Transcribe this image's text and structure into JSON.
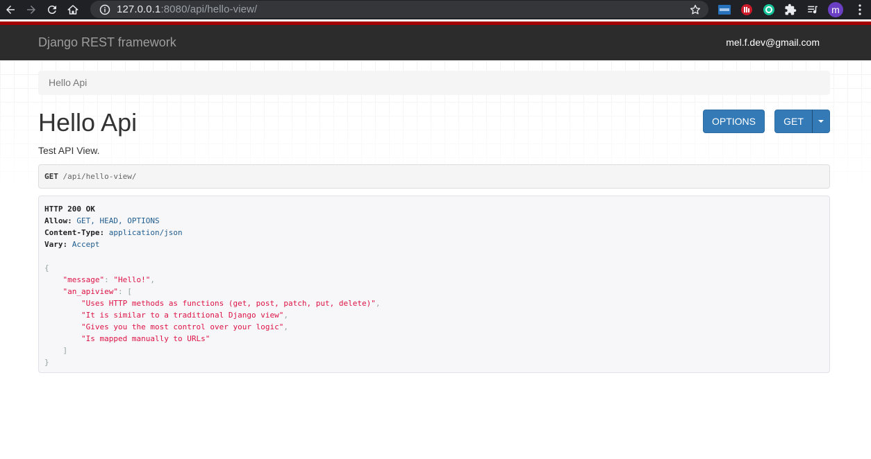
{
  "browser": {
    "url_host": "127.0.0.1",
    "url_rest": ":8080/api/hello-view/",
    "profile_initial": "m"
  },
  "navbar": {
    "brand": "Django REST framework",
    "user": "mel.f.dev@gmail.com"
  },
  "breadcrumb": "Hello Api",
  "page": {
    "title": "Hello Api",
    "description": "Test API View."
  },
  "buttons": {
    "options": "OPTIONS",
    "get": "GET"
  },
  "request": {
    "method": "GET",
    "path": " /api/hello-view/"
  },
  "response": {
    "status": "HTTP 200 OK",
    "headers": [
      {
        "name": "Allow:",
        "value": " GET, HEAD, OPTIONS"
      },
      {
        "name": "Content-Type:",
        "value": " application/json"
      },
      {
        "name": "Vary:",
        "value": " Accept"
      }
    ],
    "body": {
      "open_brace": "{",
      "message_key": "\"message\"",
      "message_value": "\"Hello!\"",
      "list_key": "\"an_apiview\"",
      "open_bracket": "[",
      "items": [
        "\"Uses HTTP methods as functions (get, post, patch, put, delete)\"",
        "\"It is similar to a traditional Django view\"",
        "\"Gives you the most control over your logic\"",
        "\"Is mapped manually to URLs\""
      ],
      "close_bracket": "]",
      "close_brace": "}"
    }
  },
  "colors": {
    "navbar_bg": "#2c2c2c",
    "navbar_accent": "#a30000",
    "button_primary": "#337ab7"
  }
}
